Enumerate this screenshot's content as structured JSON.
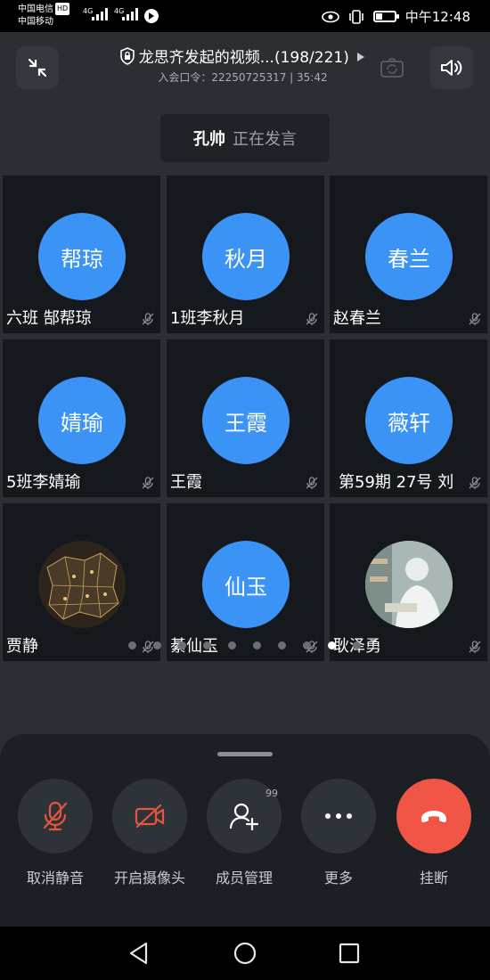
{
  "status_bar": {
    "carrier1": "中国电信",
    "hd": "HD",
    "carrier2": "中国移动",
    "net1": "4G",
    "net2": "4G",
    "time": "中午12:48"
  },
  "header": {
    "title": "龙思齐发起的视频...(198/221)",
    "meeting_code_label": "入会口令：",
    "meeting_code": "22250725317",
    "separator": " | ",
    "duration": "35:42"
  },
  "speaker": {
    "name": "孔帅",
    "status": "正在发言"
  },
  "participants": [
    {
      "avatar_text": "帮琼",
      "name": "六班 郜帮琼",
      "avatar_type": "text"
    },
    {
      "avatar_text": "秋月",
      "name": "1班李秋月",
      "avatar_type": "text"
    },
    {
      "avatar_text": "春兰",
      "name": "赵春兰",
      "avatar_type": "text"
    },
    {
      "avatar_text": "婧瑜",
      "name": "5班李婧瑜",
      "avatar_type": "text"
    },
    {
      "avatar_text": "王霞",
      "name": "王霞",
      "avatar_type": "text"
    },
    {
      "avatar_text": "薇轩",
      "name": "第59期 27号 刘",
      "avatar_type": "text"
    },
    {
      "avatar_text": "",
      "name": "贾静",
      "avatar_type": "photo-map"
    },
    {
      "avatar_text": "仙玉",
      "name": "綦仙玉",
      "avatar_type": "text"
    },
    {
      "avatar_text": "",
      "name": "耿泽勇",
      "avatar_type": "photo-person"
    }
  ],
  "pagination": {
    "current": 9,
    "total": 10
  },
  "controls": {
    "unmute": "取消静音",
    "camera": "开启摄像头",
    "members": "成员管理",
    "members_badge": "99",
    "more": "更多",
    "hangup": "挂断"
  },
  "colors": {
    "avatar_blue": "#3a93f5",
    "hangup_red": "#f05545",
    "disabled_icon_red": "#e8553f"
  }
}
